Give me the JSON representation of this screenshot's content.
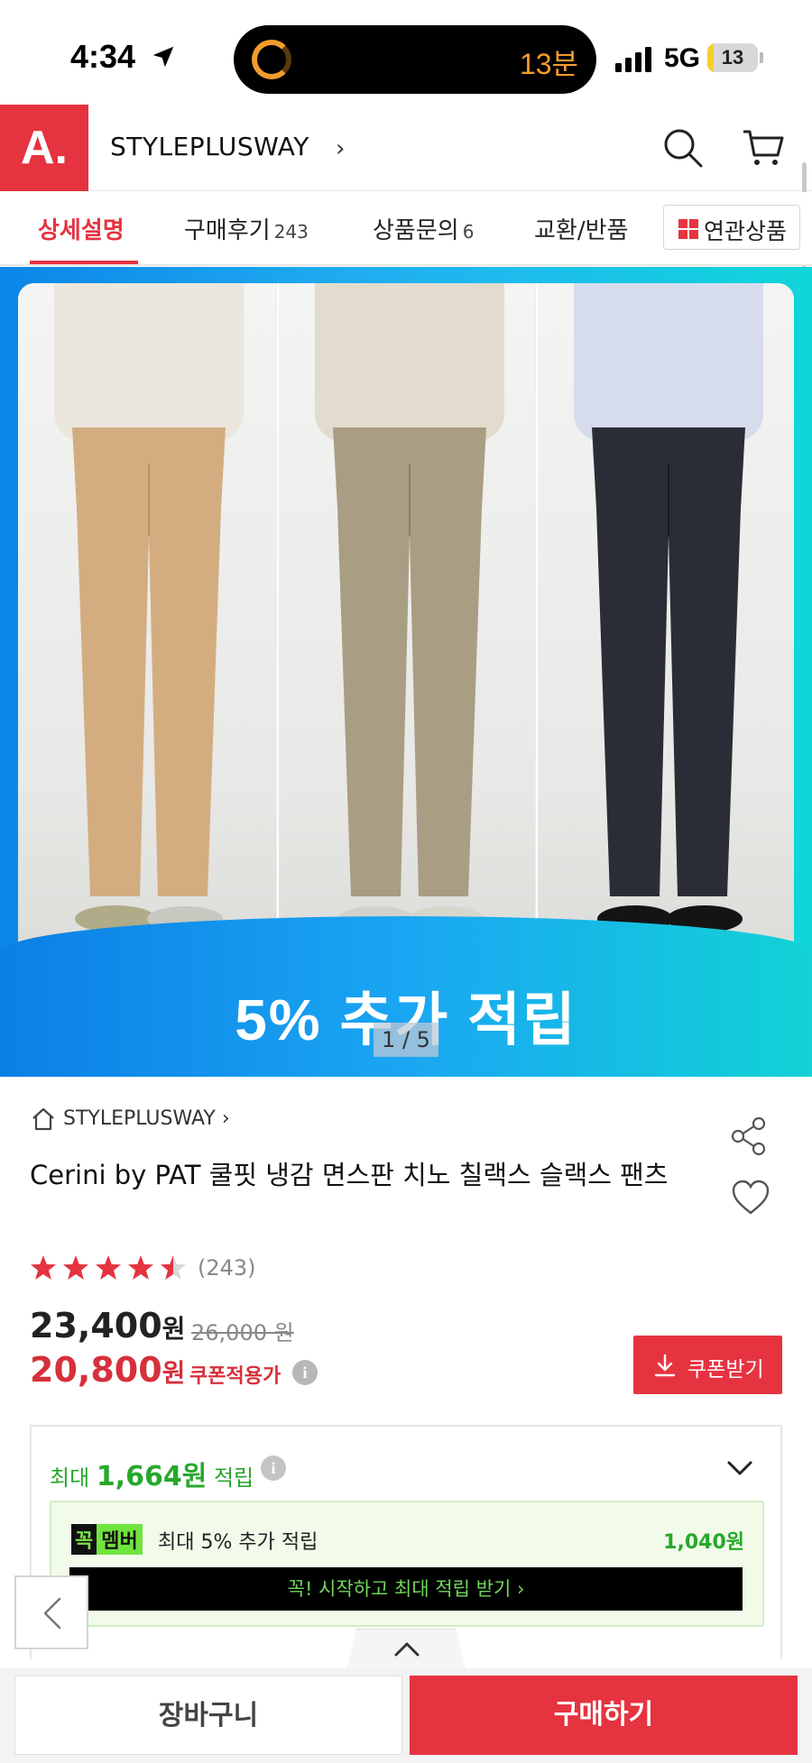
{
  "status_bar": {
    "time": "4:34",
    "activity_timer": "13분",
    "network": "5G",
    "battery_level": "13",
    "battery_fraction": 0.13
  },
  "header": {
    "logo_text": "A.",
    "brand": "STYLEPLUSWAY",
    "brand_chevron": "›",
    "icons": [
      "search-icon",
      "cart-icon"
    ]
  },
  "tabs": [
    {
      "label": "상세설명",
      "count": "",
      "active": true
    },
    {
      "label": "구매후기",
      "count": "243",
      "active": false
    },
    {
      "label": "상품문의",
      "count": "6",
      "active": false
    },
    {
      "label": "교환/반품",
      "count": "",
      "active": false
    }
  ],
  "related_button": "연관상품",
  "hero": {
    "promo_text": "5% 추가 적립",
    "pager": "1 / 5",
    "pants_colors": [
      "#d3ad80",
      "#a99d83",
      "#2b2d36"
    ]
  },
  "product": {
    "store_name": "STYLEPLUSWAY",
    "store_chevron": "›",
    "title": "Cerini by PAT 쿨핏 냉감 면스판 치노 칠랙스 슬랙스 팬츠",
    "rating_stars": 4.5,
    "review_count": "(243)",
    "price": "23,400",
    "price_unit": "원",
    "original_price": "26,000 원",
    "coupon_price": "20,800",
    "coupon_price_unit": "원",
    "coupon_label": "쿠폰적용가",
    "coupon_button": "쿠폰받기",
    "info_icon_glyph": "i"
  },
  "points": {
    "prefix": "최대",
    "amount": "1,664원",
    "suffix": "적립",
    "member_badge_1": "꼭",
    "member_badge_2": "멤버",
    "member_text": "최대 5% 추가 적립",
    "member_amount": "1,040원",
    "member_cta": "꼭! 시작하고 최대 적립 받기  ›"
  },
  "bottom": {
    "cart_label": "장바구니",
    "buy_label": "구매하기"
  },
  "colors": {
    "accent": "#e63340",
    "points_green": "#27a82c",
    "hero_blue": "#1aa6f2",
    "hero_cyan": "#12d2d6"
  }
}
